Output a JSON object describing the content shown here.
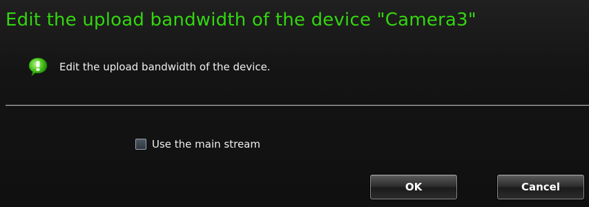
{
  "dialog": {
    "title": "Edit the upload bandwidth of the device \"Camera3\"",
    "title_color": "#33d60f",
    "info_icon": "info-bubble-icon",
    "info_text": "Edit the upload bandwidth of the device.",
    "main_stream_label": "Use the main stream",
    "main_stream_checked": false,
    "ok_label": "OK",
    "cancel_label": "Cancel"
  }
}
